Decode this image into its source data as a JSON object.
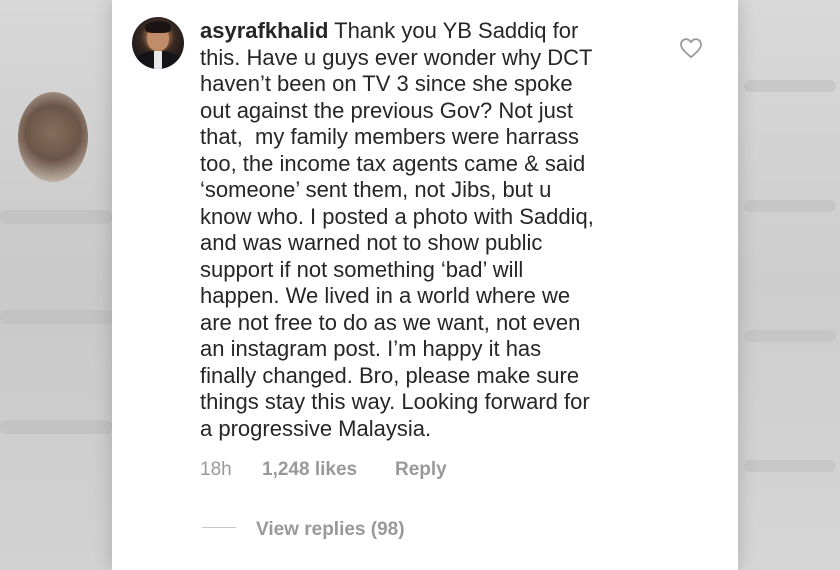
{
  "comment": {
    "username": "asyrafkhalid",
    "lines": [
      "Thank you YB Saddiq for",
      "this. Have u guys ever wonder why DCT",
      "haven’t been on TV 3 since she spoke",
      "out against the previous Gov? Not just",
      "that,  my family members were harrass",
      "too, the income tax agents came & said",
      "‘someone’ sent them, not Jibs, but u",
      "know who. I posted a photo with Saddiq,",
      "and was warned not to show public",
      "support if not something ‘bad’ will",
      "happen. We lived in a world where we",
      "are not free to do as we want, not even",
      "an instagram post. I’m happy it has",
      "finally changed. Bro, please make sure",
      "things stay this way. Looking forward for",
      "a progressive Malaysia."
    ],
    "time": "18h",
    "likes": "1,248 likes",
    "reply_label": "Reply",
    "view_replies_label": "View replies (98)"
  },
  "icons": {
    "avatar": "user-avatar",
    "like": "heart-outline-icon"
  },
  "colors": {
    "text": "#262626",
    "muted": "#999999",
    "panel": "#ffffff"
  }
}
